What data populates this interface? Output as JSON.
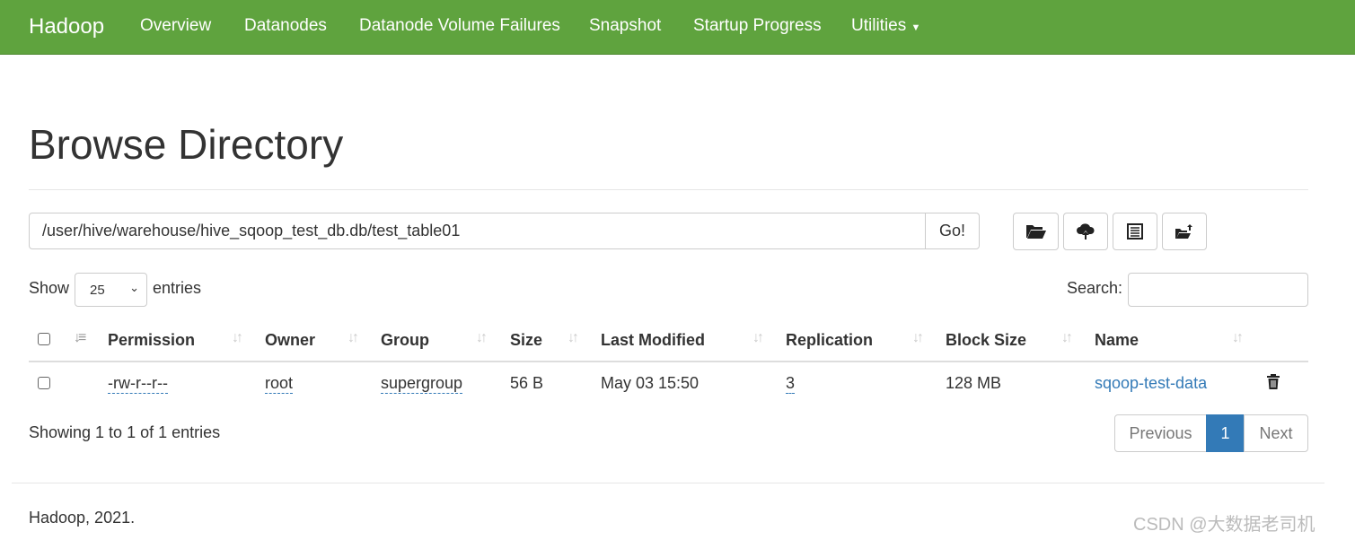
{
  "navbar": {
    "brand": "Hadoop",
    "items": [
      "Overview",
      "Datanodes",
      "Datanode Volume Failures",
      "Snapshot",
      "Startup Progress",
      "Utilities"
    ],
    "color": "#5fa33e"
  },
  "page": {
    "title": "Browse Directory"
  },
  "path": {
    "value": "/user/hive/warehouse/hive_sqoop_test_db.db/test_table01",
    "go_label": "Go!"
  },
  "toolbar": {
    "icons": [
      "folder-open-icon",
      "cloud-upload-icon",
      "list-icon",
      "folder-move-icon"
    ]
  },
  "length": {
    "show": "Show",
    "value": "25",
    "entries": "entries"
  },
  "search": {
    "label": "Search:",
    "value": ""
  },
  "table": {
    "headers": [
      "Permission",
      "Owner",
      "Group",
      "Size",
      "Last Modified",
      "Replication",
      "Block Size",
      "Name"
    ],
    "rows": [
      {
        "permission": "-rw-r--r--",
        "owner": "root",
        "group": "supergroup",
        "size": "56 B",
        "modified": "May 03 15:50",
        "replication": "3",
        "block_size": "128 MB",
        "name": "sqoop-test-data"
      }
    ]
  },
  "info": "Showing 1 to 1 of 1 entries",
  "pagination": {
    "previous": "Previous",
    "current": "1",
    "next": "Next",
    "accent": "#337ab7"
  },
  "footer": "Hadoop, 2021.",
  "watermark": "CSDN @大数据老司机"
}
